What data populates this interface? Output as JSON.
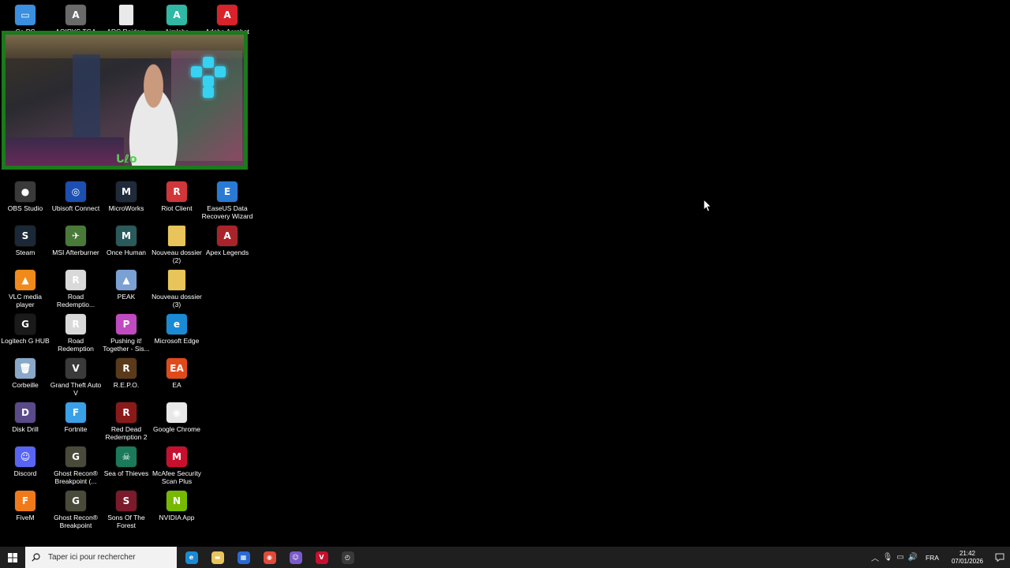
{
  "desktop": {
    "icons": [
      {
        "label": "Ce PC",
        "icon": "computer-icon",
        "color": "#3a8fe0",
        "glyph": "▭",
        "col": 0,
        "row": 0
      },
      {
        "label": "AQIRYS TGA",
        "icon": "aqirys-icon",
        "color": "#6a6a6a",
        "glyph": "A",
        "col": 1,
        "row": 0
      },
      {
        "label": "ARC Raiders",
        "icon": "file-icon",
        "color": "#e9e9e9",
        "glyph": "",
        "col": 2,
        "row": 0
      },
      {
        "label": "Aimlabs",
        "icon": "aimlabs-icon",
        "color": "#2fb8a4",
        "glyph": "A",
        "col": 3,
        "row": 0
      },
      {
        "label": "Adobe Acrobat",
        "icon": "acrobat-icon",
        "color": "#d8232a",
        "glyph": "A",
        "col": 4,
        "row": 0
      },
      {
        "label": "OBS Studio",
        "icon": "obs-icon",
        "color": "#3a3a3a",
        "glyph": "●",
        "col": 0,
        "row": 1
      },
      {
        "label": "Ubisoft Connect",
        "icon": "ubisoft-icon",
        "color": "#1c4fb0",
        "glyph": "◎",
        "col": 1,
        "row": 1
      },
      {
        "label": "MicroWorks",
        "icon": "microworks-icon",
        "color": "#1f2a3a",
        "glyph": "M",
        "col": 2,
        "row": 1
      },
      {
        "label": "Riot Client",
        "icon": "riot-icon",
        "color": "#d13639",
        "glyph": "R",
        "col": 3,
        "row": 1
      },
      {
        "label": "EaseUS Data Recovery Wizard",
        "icon": "easeus-icon",
        "color": "#2a7ad4",
        "glyph": "E",
        "col": 4,
        "row": 1
      },
      {
        "label": "Steam",
        "icon": "steam-icon",
        "color": "#1b2838",
        "glyph": "S",
        "col": 0,
        "row": 2
      },
      {
        "label": "MSI Afterburner",
        "icon": "afterburner-icon",
        "color": "#4a7a3a",
        "glyph": "✈",
        "col": 1,
        "row": 2
      },
      {
        "label": "Once Human",
        "icon": "oncehuman-icon",
        "color": "#2a5a5a",
        "glyph": "M",
        "col": 2,
        "row": 2
      },
      {
        "label": "Nouveau dossier (2)",
        "icon": "folder-icon",
        "color": "#e8c45a",
        "glyph": "",
        "col": 3,
        "row": 2
      },
      {
        "label": "Apex Legends",
        "icon": "apex-icon",
        "color": "#a8242a",
        "glyph": "A",
        "col": 4,
        "row": 2
      },
      {
        "label": "VLC media player",
        "icon": "vlc-icon",
        "color": "#f08a1a",
        "glyph": "▲",
        "col": 0,
        "row": 3
      },
      {
        "label": "Road Redemptio...",
        "icon": "road-redemption-icon",
        "color": "#d9d9d9",
        "glyph": "R",
        "col": 1,
        "row": 3
      },
      {
        "label": "PEAK",
        "icon": "peak-icon",
        "color": "#7aa0d4",
        "glyph": "▲",
        "col": 2,
        "row": 3
      },
      {
        "label": "Nouveau dossier (3)",
        "icon": "folder-icon",
        "color": "#e8c45a",
        "glyph": "",
        "col": 3,
        "row": 3
      },
      {
        "label": "Logitech G HUB",
        "icon": "ghub-icon",
        "color": "#1a1a1a",
        "glyph": "G",
        "col": 0,
        "row": 4
      },
      {
        "label": "Road Redemption",
        "icon": "road-redemption-icon",
        "color": "#d9d9d9",
        "glyph": "R",
        "col": 1,
        "row": 4
      },
      {
        "label": "Pushing it! Together - Sis...",
        "icon": "pushing-it-icon",
        "color": "#c04ac0",
        "glyph": "P",
        "col": 2,
        "row": 4
      },
      {
        "label": "Microsoft Edge",
        "icon": "edge-icon",
        "color": "#1a8ad4",
        "glyph": "e",
        "col": 3,
        "row": 4
      },
      {
        "label": "Corbeille",
        "icon": "recycle-bin-icon",
        "color": "#8aa8c8",
        "glyph": "🗑",
        "col": 0,
        "row": 5
      },
      {
        "label": "Grand Theft Auto V",
        "icon": "gta-icon",
        "color": "#3a3a3a",
        "glyph": "V",
        "col": 1,
        "row": 5
      },
      {
        "label": "R.E.P.O.",
        "icon": "repo-icon",
        "color": "#5a3a1a",
        "glyph": "R",
        "col": 2,
        "row": 5
      },
      {
        "label": "EA",
        "icon": "ea-icon",
        "color": "#e04a1a",
        "glyph": "EA",
        "col": 3,
        "row": 5
      },
      {
        "label": "Disk Drill",
        "icon": "disk-drill-icon",
        "color": "#5a4a8a",
        "glyph": "D",
        "col": 0,
        "row": 6
      },
      {
        "label": "Fortnite",
        "icon": "fortnite-icon",
        "color": "#3aa0e8",
        "glyph": "F",
        "col": 1,
        "row": 6
      },
      {
        "label": "Red Dead Redemption 2",
        "icon": "rdr2-icon",
        "color": "#8a1a1a",
        "glyph": "R",
        "col": 2,
        "row": 6
      },
      {
        "label": "Google Chrome",
        "icon": "chrome-icon",
        "color": "#e8e8e8",
        "glyph": "◉",
        "col": 3,
        "row": 6
      },
      {
        "label": "Discord",
        "icon": "discord-icon",
        "color": "#5865f2",
        "glyph": "☺",
        "col": 0,
        "row": 7
      },
      {
        "label": "Ghost Recon® Breakpoint (...",
        "icon": "ghost-recon-icon",
        "color": "#4a4a3a",
        "glyph": "G",
        "col": 1,
        "row": 7
      },
      {
        "label": "Sea of Thieves",
        "icon": "sea-of-thieves-icon",
        "color": "#1a7a5a",
        "glyph": "☠",
        "col": 2,
        "row": 7
      },
      {
        "label": "McAfee Security Scan Plus",
        "icon": "mcafee-icon",
        "color": "#c8102e",
        "glyph": "M",
        "col": 3,
        "row": 7
      },
      {
        "label": "FiveM",
        "icon": "fivem-icon",
        "color": "#f07a1a",
        "glyph": "F",
        "col": 0,
        "row": 8
      },
      {
        "label": "Ghost Recon® Breakpoint",
        "icon": "ghost-recon-icon",
        "color": "#4a4a3a",
        "glyph": "G",
        "col": 1,
        "row": 8
      },
      {
        "label": "Sons Of The Forest",
        "icon": "sons-of-forest-icon",
        "color": "#7a1a2a",
        "glyph": "S",
        "col": 2,
        "row": 8
      },
      {
        "label": "NVIDIA App",
        "icon": "nvidia-icon",
        "color": "#76b900",
        "glyph": "N",
        "col": 3,
        "row": 8
      }
    ]
  },
  "webcam": {
    "logo_text": "ᒐℓᴏ",
    "border_color": "#1b7a1b"
  },
  "taskbar": {
    "search_placeholder": "Taper ici pour rechercher",
    "pinned": [
      {
        "icon": "edge-icon",
        "color": "#1a8ad4",
        "glyph": "e"
      },
      {
        "icon": "file-explorer-icon",
        "color": "#e8c45a",
        "glyph": "▬"
      },
      {
        "icon": "store-icon",
        "color": "#2a6ad4",
        "glyph": "▦"
      },
      {
        "icon": "chrome-icon",
        "color": "#e04a3a",
        "glyph": "◉"
      },
      {
        "icon": "discord-bot-icon",
        "color": "#7a5ac8",
        "glyph": "☺"
      },
      {
        "icon": "voicemeeter-icon",
        "color": "#c8102e",
        "glyph": "V"
      },
      {
        "icon": "speedometer-icon",
        "color": "#3a3a3a",
        "glyph": "◴"
      }
    ],
    "language": "FRA",
    "time": "21:42",
    "date": "07/01/2026"
  }
}
